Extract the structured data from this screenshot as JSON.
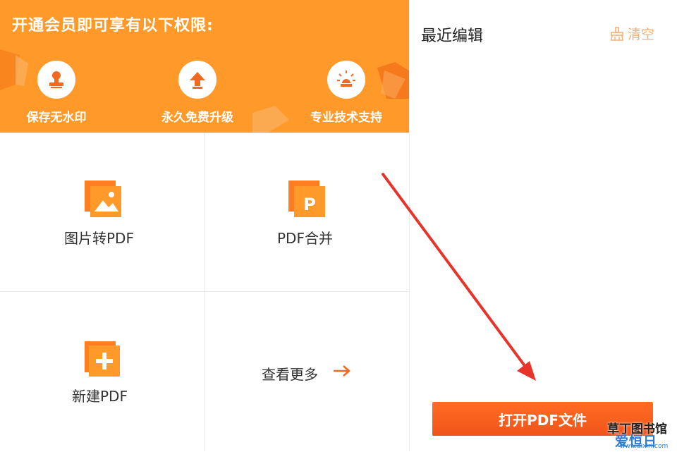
{
  "promo": {
    "title": "开通会员即可享有以下权限:",
    "perks": [
      {
        "label": "保存无水印",
        "icon": "stamp-icon"
      },
      {
        "label": "永久免费升级",
        "icon": "upgrade-arrow-icon"
      },
      {
        "label": "专业技术支持",
        "icon": "support-lightbulb-icon"
      }
    ]
  },
  "features": {
    "image_to_pdf": {
      "label": "图片转PDF",
      "icon": "image-icon"
    },
    "pdf_merge": {
      "label": "PDF合并",
      "icon": "pdf-p-icon"
    },
    "new_pdf": {
      "label": "新建PDF",
      "icon": "plus-icon"
    },
    "more": {
      "label": "查看更多",
      "icon": "arrow-right-icon"
    }
  },
  "recent": {
    "title": "最近编辑",
    "clear_label": "清空",
    "clear_icon": "broom-icon"
  },
  "open_button": {
    "label": "打开PDF文件"
  },
  "watermark": {
    "line1": "草丁图书馆",
    "line2": "爱恒日",
    "line3": "www.aixiri.com"
  },
  "colors": {
    "banner": "#ff9a2a",
    "accent": "#f26a22",
    "button": "#f0541a",
    "annotation_arrow": "#e8332a"
  }
}
